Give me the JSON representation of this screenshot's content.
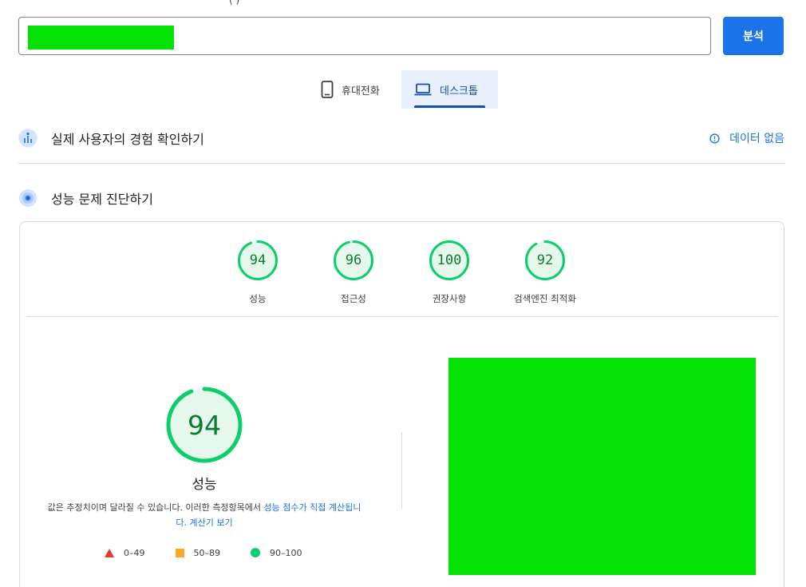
{
  "top_fragment": "(     )",
  "url_input": {
    "value": "",
    "placeholder": ""
  },
  "analyze_label": "분석",
  "tabs": [
    {
      "label": "휴대전화",
      "icon": "smartphone-icon",
      "active": false
    },
    {
      "label": "데스크톱",
      "icon": "laptop-icon",
      "active": true
    }
  ],
  "field_data": {
    "title": "실제 사용자의 경험 확인하기",
    "status": "데이터 없음",
    "icon": "field-data-icon"
  },
  "lab_data": {
    "title": "성능 문제 진단하기",
    "icon": "diagnostics-icon"
  },
  "scores": [
    {
      "value": "94",
      "label": "성능",
      "fraction": 0.94
    },
    {
      "value": "96",
      "label": "접근성",
      "fraction": 0.96
    },
    {
      "value": "100",
      "label": "권장사항",
      "fraction": 1.0
    },
    {
      "value": "92",
      "label": "검색엔진 최적화",
      "fraction": 0.92
    }
  ],
  "performance": {
    "value": "94",
    "fraction": 0.94,
    "label": "성능",
    "desc_text": "값은 추정치이며 달라질 수 있습니다. 이러한 측정항목에서 ",
    "desc_link1": "성능 점수가 직접 계산됩니다.",
    "desc_link2": "계산기 보기"
  },
  "legend": [
    {
      "range": "0–49",
      "shape": "triangle",
      "color": "#e53935"
    },
    {
      "range": "50–89",
      "shape": "square",
      "color": "#ffa726"
    },
    {
      "range": "90–100",
      "shape": "circle",
      "color": "#0cce6b"
    }
  ],
  "colors": {
    "accent": "#1a73e8",
    "pass": "#0cce6b",
    "pass_text": "#0a7c30",
    "pass_bg": "#e6f7ec",
    "redact": "#05e105"
  }
}
